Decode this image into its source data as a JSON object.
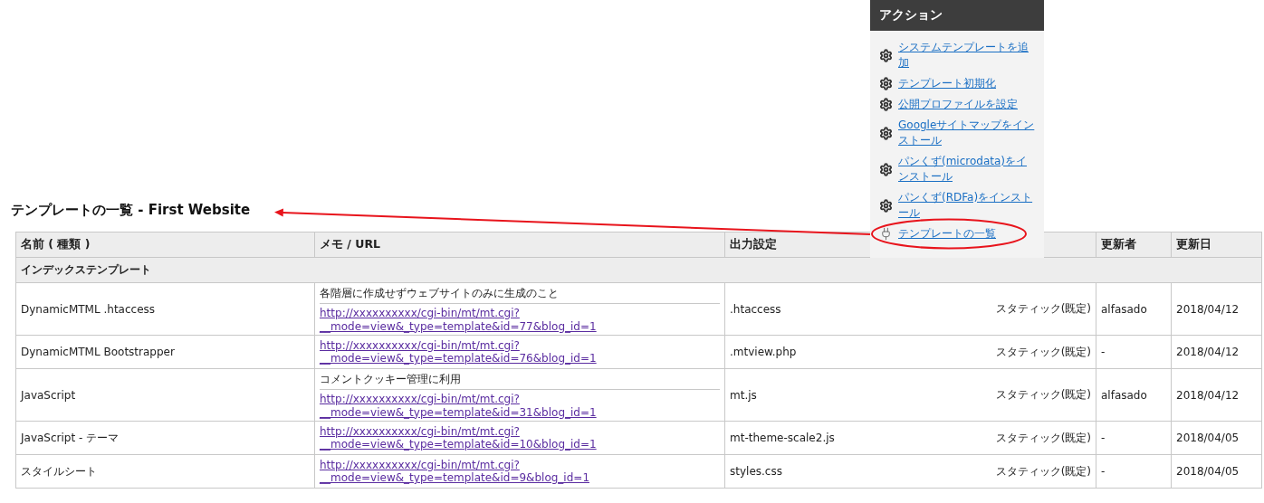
{
  "actions": {
    "title": "アクション",
    "items": [
      {
        "label": "システムテンプレートを追加",
        "kind": "gear",
        "annotated": false
      },
      {
        "label": "テンプレート初期化",
        "kind": "gear",
        "annotated": false
      },
      {
        "label": "公開プロファイルを設定",
        "kind": "gear",
        "annotated": false
      },
      {
        "label": "Googleサイトマップをインストール",
        "kind": "gear",
        "annotated": false
      },
      {
        "label": "パンくず(microdata)をインストール",
        "kind": "gear",
        "annotated": false
      },
      {
        "label": "パンくず(RDFa)をインストール",
        "kind": "gear",
        "annotated": false
      },
      {
        "label": "テンプレートの一覧",
        "kind": "plug",
        "annotated": true
      }
    ]
  },
  "page_title": "テンプレートの一覧 - First Website",
  "table": {
    "columns": [
      "名前 ( 種類 )",
      "メモ / URL",
      "出力設定",
      "更新者",
      "更新日"
    ],
    "group": "インデックステンプレート",
    "rows": [
      {
        "name": "DynamicMTML .htaccess",
        "memo": "各階層に作成せずウェブサイトのみに生成のこと",
        "url": "http://xxxxxxxxxx/cgi-bin/mt/mt.cgi?__mode=view&_type=template&id=77&blog_id=1",
        "output": ".htaccess",
        "publish": "スタティック(既定)",
        "author": "alfasado",
        "date": "2018/04/12"
      },
      {
        "name": "DynamicMTML Bootstrapper",
        "url": "http://xxxxxxxxxx/cgi-bin/mt/mt.cgi?__mode=view&_type=template&id=76&blog_id=1",
        "output": ".mtview.php",
        "publish": "スタティック(既定)",
        "author": "-",
        "date": "2018/04/12"
      },
      {
        "name": "JavaScript",
        "memo": "コメントクッキー管理に利用",
        "url": "http://xxxxxxxxxx/cgi-bin/mt/mt.cgi?__mode=view&_type=template&id=31&blog_id=1",
        "output": "mt.js",
        "publish": "スタティック(既定)",
        "author": "alfasado",
        "date": "2018/04/12"
      },
      {
        "name": "JavaScript - テーマ",
        "url": "http://xxxxxxxxxx/cgi-bin/mt/mt.cgi?__mode=view&_type=template&id=10&blog_id=1",
        "output": "mt-theme-scale2.js",
        "publish": "スタティック(既定)",
        "author": "-",
        "date": "2018/04/05"
      },
      {
        "name": "スタイルシート",
        "url": "http://xxxxxxxxxx/cgi-bin/mt/mt.cgi?__mode=view&_type=template&id=9&blog_id=1",
        "output": "styles.css",
        "publish": "スタティック(既定)",
        "author": "-",
        "date": "2018/04/05"
      }
    ]
  }
}
